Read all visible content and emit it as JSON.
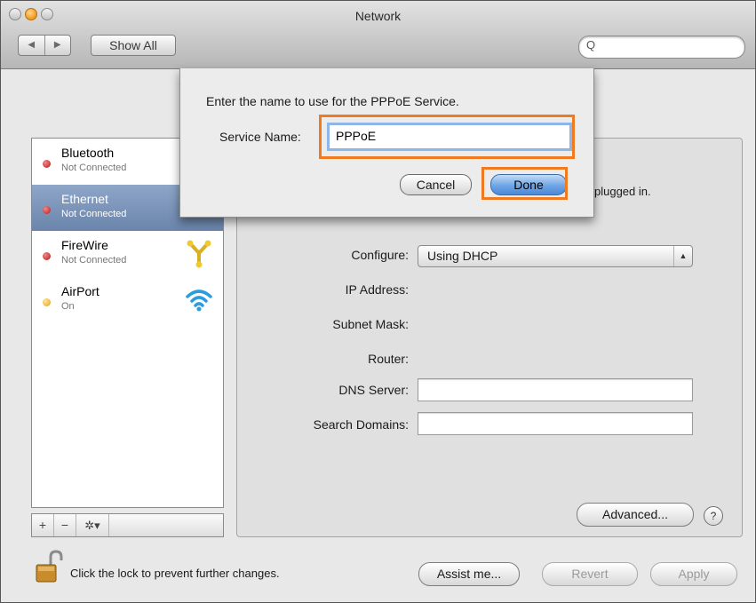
{
  "window": {
    "title": "Network",
    "show_all": "Show All",
    "back_glyph": "◀",
    "forward_glyph": "▶",
    "search_placeholder": "",
    "search_icon": "Q"
  },
  "services": [
    {
      "name": "Bluetooth",
      "status": "Not Connected",
      "status_color": "#c41e1e",
      "selected": false,
      "icon": "bluetooth-icon"
    },
    {
      "name": "Ethernet",
      "status": "Not Connected",
      "status_color": "#c41e1e",
      "selected": true,
      "icon": "ethernet-icon"
    },
    {
      "name": "FireWire",
      "status": "Not Connected",
      "status_color": "#c41e1e",
      "selected": false,
      "icon": "firewire-icon"
    },
    {
      "name": "AirPort",
      "status": "On",
      "status_color": "#e3a81a",
      "selected": false,
      "icon": "wifi-icon"
    }
  ],
  "sidebar_toolbar": {
    "add": "+",
    "remove": "−",
    "gear": "✲▾"
  },
  "form": {
    "configure_label": "Configure:",
    "configure_value": "Using DHCP",
    "ip_label": "IP Address:",
    "subnet_label": "Subnet Mask:",
    "router_label": "Router:",
    "dns_label": "DNS Server:",
    "dns_value": "",
    "search_domains_label": "Search Domains:",
    "search_domains_value": "",
    "partial_status_text": "plugged in."
  },
  "buttons": {
    "advanced": "Advanced...",
    "help": "?",
    "assist": "Assist me...",
    "revert": "Revert",
    "apply": "Apply"
  },
  "lock_message": "Click the lock to prevent further changes.",
  "sheet": {
    "message": "Enter the name to use for the PPPoE Service.",
    "service_name_label": "Service Name:",
    "service_name_value": "PPPoE",
    "cancel": "Cancel",
    "done": "Done"
  },
  "colors": {
    "highlight": "#f07a20",
    "selection": "#7a93b8",
    "default_button": "#6ea5e6"
  }
}
